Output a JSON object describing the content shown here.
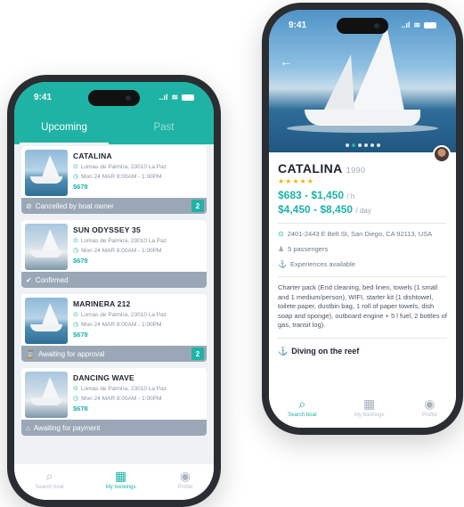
{
  "left_phone": {
    "status": {
      "time": "9:41",
      "signal": "..ıl"
    },
    "tabs": [
      {
        "label": "Upcoming",
        "active": true
      },
      {
        "label": "Past",
        "active": false
      }
    ],
    "bookings": [
      {
        "name": "CATALINA",
        "location": "Lomas de Palmira, 23010 La Paz",
        "datetime": "Mon 24 MAR 8:00AM - 1:00PM",
        "price": "$678",
        "status": "Cancelled by boat owner",
        "status_icon": "block-icon",
        "badge": "2"
      },
      {
        "name": "SUN ODYSSEY 35",
        "location": "Lomas de Palmira, 23010 La Paz",
        "datetime": "Mon 24 MAR 8:00AM - 1:00PM",
        "price": "$678",
        "status": "Confirmed",
        "status_icon": "check-circle-icon",
        "badge": ""
      },
      {
        "name": "MARINERA 212",
        "location": "Lomas de Palmira, 23010 La Paz",
        "datetime": "Mon 24 MAR 8:00AM - 1:00PM",
        "price": "$678",
        "status": "Awaiting for approval",
        "status_icon": "hourglass-icon",
        "badge": "2"
      },
      {
        "name": "DANCING WAVE",
        "location": "Lomas de Palmira, 23010 La Paz",
        "datetime": "Mon 24 MAR 8:00AM - 1:00PM",
        "price": "$678",
        "status": "Awaiting for payment",
        "status_icon": "bank-icon",
        "badge": ""
      }
    ],
    "nav": [
      {
        "label": "Search boat",
        "icon": "search-icon",
        "active": false
      },
      {
        "label": "My bookings",
        "icon": "calendar-icon",
        "active": true
      },
      {
        "label": "Profile",
        "icon": "profile-icon",
        "active": false
      }
    ]
  },
  "right_phone": {
    "status": {
      "time": "9:41",
      "signal": "..ıl"
    },
    "boat_name": "CATALINA",
    "year": "1990",
    "stars": "★★★★★",
    "rating": 5,
    "rate_hour": "$683 - $1,450",
    "rate_hour_unit": "/ h",
    "rate_day": "$4,450 - $8,450",
    "rate_day_unit": "/ day",
    "address": "2401-2443 E Belt St, San Diego, CA 92113, USA",
    "passengers": "5 passengers",
    "experiences": "Experiences available",
    "description": "Charter pack (End cleaning, bed linen, towels (1 small and 1 medium/person), WIFI, starter kit (1 dishtowel, toilete paper, dustbin bag, 1 roll of paper towels, dish soap and sponge), outboard engine + 5 l fuel, 2 bottles of gas, transit log).",
    "experience_title": "Diving on the reef",
    "nav": [
      {
        "label": "Search boat",
        "icon": "search-icon",
        "active": true
      },
      {
        "label": "My bookings",
        "icon": "calendar-icon",
        "active": false
      },
      {
        "label": "Profile",
        "icon": "profile-icon",
        "active": false
      }
    ]
  },
  "colors": {
    "accent": "#1fb3a6",
    "status_grey": "#9aa7b6",
    "star": "#f2b600"
  }
}
